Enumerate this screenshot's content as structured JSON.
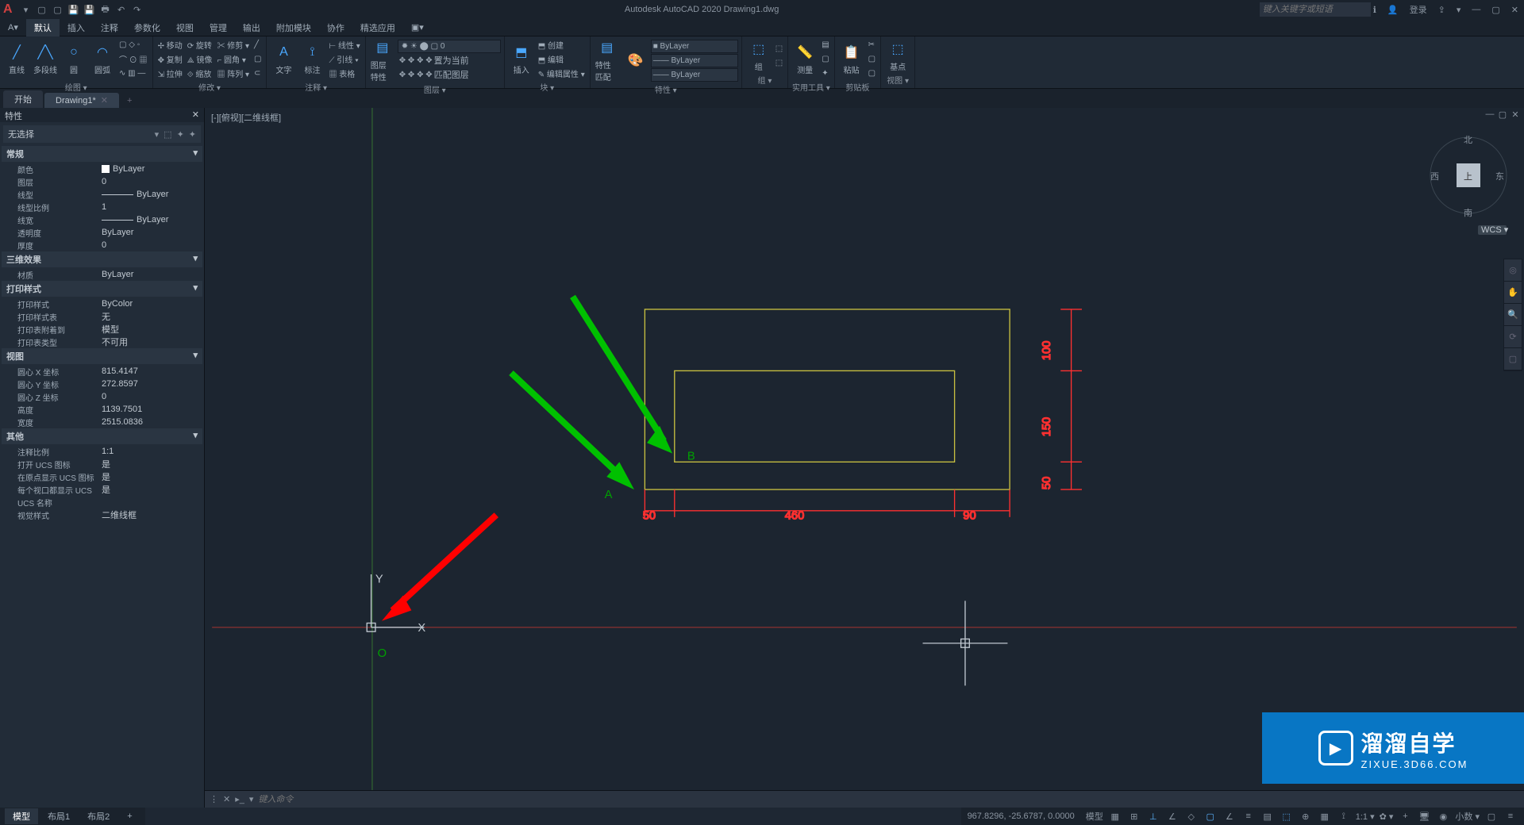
{
  "app": {
    "title": "Autodesk AutoCAD 2020   Drawing1.dwg",
    "search_placeholder": "键入关键字或短语",
    "login": "登录"
  },
  "menu": {
    "tabs": [
      "默认",
      "插入",
      "注释",
      "参数化",
      "视图",
      "管理",
      "输出",
      "附加模块",
      "协作",
      "精选应用"
    ],
    "active": 0
  },
  "ribbon": {
    "panels": [
      {
        "title": "绘图 ▾",
        "big": [
          {
            "ico": "╱",
            "lbl": "直线"
          },
          {
            "ico": "╱╲",
            "lbl": "多段线"
          },
          {
            "ico": "○",
            "lbl": "圆"
          },
          {
            "ico": "◠",
            "lbl": "圆弧"
          }
        ],
        "col": [
          [
            "口",
            "◇",
            "◦"
          ],
          [
            "⌒",
            "⊙",
            "▦"
          ],
          [
            "∿",
            "▥",
            "—"
          ]
        ]
      },
      {
        "title": "修改 ▾",
        "col": [
          [
            "✢ 移动",
            "⟳ 旋转",
            "✂ 修剪 ▾",
            "—"
          ],
          [
            "✥ 复制",
            "⟁ 镜像",
            "⌐ 圆角 ▾",
            "□"
          ],
          [
            "⇲ 拉伸",
            "⟐ 缩放",
            "▦ 阵列 ▾",
            "⊂"
          ]
        ]
      },
      {
        "title": "注释 ▾",
        "big": [
          {
            "ico": "A",
            "lbl": "文字"
          },
          {
            "ico": "⟟",
            "lbl": "标注"
          }
        ],
        "col": [
          [
            "⊢ 线性 ▾"
          ],
          [
            "⟋ 引线 ▾"
          ],
          [
            "▦ 表格"
          ]
        ]
      },
      {
        "title": "图层 ▾",
        "big": [
          {
            "ico": "▤",
            "lbl": "图层\n特性"
          }
        ],
        "row": "✹ ☀ ⬤ ▢ 0",
        "col": [
          [
            "✥",
            "✥",
            "✥",
            "✥"
          ],
          [
            "✥",
            "✥",
            "✥",
            "置为当前"
          ],
          [
            "✥",
            "✥",
            "✥",
            "匹配图层"
          ]
        ]
      },
      {
        "title": "块 ▾",
        "big": [
          {
            "ico": "⬒",
            "lbl": "插入"
          }
        ],
        "col": [
          [
            "⬒ 创建"
          ],
          [
            "⬒ 编辑"
          ],
          [
            "✎ 编辑属性 ▾"
          ]
        ]
      },
      {
        "title": "特性 ▾",
        "big": [
          {
            "ico": "▤",
            "lbl": "特性\n匹配"
          }
        ],
        "sel": [
          "■ ByLayer",
          "—— ByLayer",
          "—— ByLayer"
        ]
      },
      {
        "title": "组 ▾",
        "big": [
          {
            "ico": "⬚",
            "lbl": "组"
          }
        ],
        "col": [
          [
            "⬚"
          ],
          [
            "⬚"
          ]
        ]
      },
      {
        "title": "实用工具 ▾",
        "big": [
          {
            "ico": "📏",
            "lbl": "测量"
          }
        ],
        "col": [
          [
            "▤"
          ],
          [
            "▢"
          ],
          [
            "✦"
          ]
        ]
      },
      {
        "title": "剪贴板",
        "big": [
          {
            "ico": "📋",
            "lbl": "粘贴"
          }
        ],
        "col": [
          [
            "✂"
          ],
          [
            "▢"
          ],
          [
            "▢"
          ]
        ]
      },
      {
        "title": "视图 ▾",
        "big": [
          {
            "ico": "⬚",
            "lbl": "基点"
          }
        ]
      }
    ]
  },
  "doctabs": {
    "tabs": [
      "开始",
      "Drawing1*"
    ],
    "active": 1
  },
  "canvas": {
    "viewlabel": "[-][俯视][二维线框]"
  },
  "viewcube": {
    "top": "上",
    "n": "北",
    "s": "南",
    "e": "东",
    "w": "西",
    "wcs": "WCS ▾"
  },
  "prop": {
    "title": "特性",
    "selection": "无选择",
    "sections": [
      {
        "name": "常规",
        "rows": [
          {
            "k": "颜色",
            "v": "ByLayer",
            "sw": true
          },
          {
            "k": "图层",
            "v": "0"
          },
          {
            "k": "线型",
            "v": "ByLayer",
            "line": true
          },
          {
            "k": "线型比例",
            "v": "1"
          },
          {
            "k": "线宽",
            "v": "ByLayer",
            "line": true
          },
          {
            "k": "透明度",
            "v": "ByLayer"
          },
          {
            "k": "厚度",
            "v": "0"
          }
        ]
      },
      {
        "name": "三维效果",
        "rows": [
          {
            "k": "材质",
            "v": "ByLayer"
          }
        ]
      },
      {
        "name": "打印样式",
        "rows": [
          {
            "k": "打印样式",
            "v": "ByColor"
          },
          {
            "k": "打印样式表",
            "v": "无"
          },
          {
            "k": "打印表附着到",
            "v": "模型"
          },
          {
            "k": "打印表类型",
            "v": "不可用"
          }
        ]
      },
      {
        "name": "视图",
        "rows": [
          {
            "k": "圆心 X 坐标",
            "v": "815.4147"
          },
          {
            "k": "圆心 Y 坐标",
            "v": "272.8597"
          },
          {
            "k": "圆心 Z 坐标",
            "v": "0"
          },
          {
            "k": "高度",
            "v": "1139.7501"
          },
          {
            "k": "宽度",
            "v": "2515.0836"
          }
        ]
      },
      {
        "name": "其他",
        "rows": [
          {
            "k": "注释比例",
            "v": "1:1"
          },
          {
            "k": "打开 UCS 图标",
            "v": "是"
          },
          {
            "k": "在原点显示 UCS 图标",
            "v": "是"
          },
          {
            "k": "每个视口都显示 UCS",
            "v": "是"
          },
          {
            "k": "UCS 名称",
            "v": ""
          },
          {
            "k": "视觉样式",
            "v": "二维线框"
          }
        ]
      }
    ]
  },
  "drawing": {
    "labels": {
      "A": "A",
      "B": "B",
      "O": "O",
      "X": "X",
      "Y": "Y"
    },
    "dims": {
      "d50a": "50",
      "d460": "460",
      "d90": "90",
      "d50b": "50",
      "d150": "150",
      "d100": "100"
    }
  },
  "cmd": {
    "placeholder": "键入命令"
  },
  "modeltabs": {
    "tabs": [
      "模型",
      "布局1",
      "布局2"
    ],
    "active": 0
  },
  "status": {
    "coords": "967.8296, -25.6787, 0.0000",
    "model": "模型",
    "scale": "1:1 ▾",
    "gear": "✿ ▾",
    "dec": "小数 ▾"
  },
  "watermark": {
    "zh": "溜溜自学",
    "en": "ZIXUE.3D66.COM"
  }
}
